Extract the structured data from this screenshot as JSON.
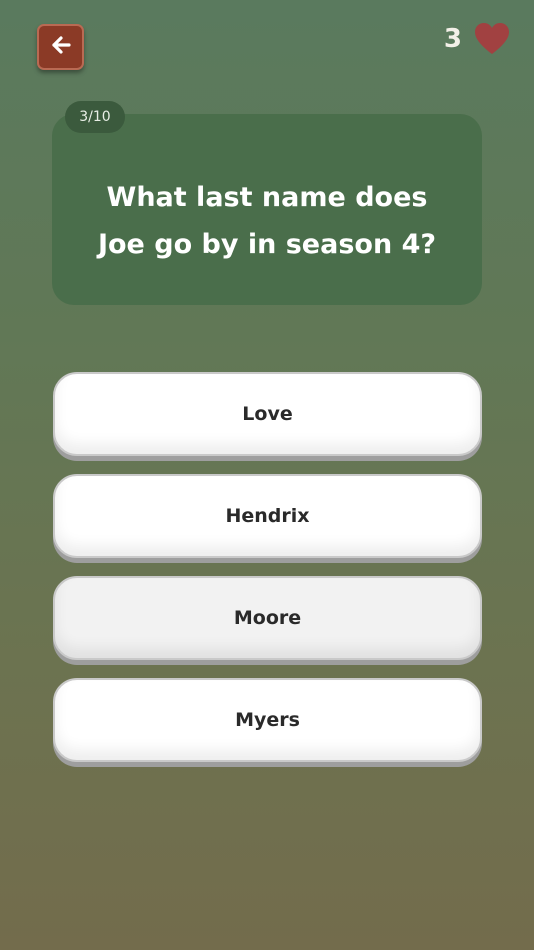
{
  "header": {
    "back_icon": "arrow-left-icon",
    "lives_count": "3",
    "heart_icon": "heart-icon",
    "heart_color": "#a14141"
  },
  "question": {
    "progress": "3/10",
    "text": "What last name does Joe go by in season 4?"
  },
  "answers": [
    {
      "label": "Love"
    },
    {
      "label": "Hendrix"
    },
    {
      "label": "Moore"
    },
    {
      "label": "Myers"
    }
  ]
}
